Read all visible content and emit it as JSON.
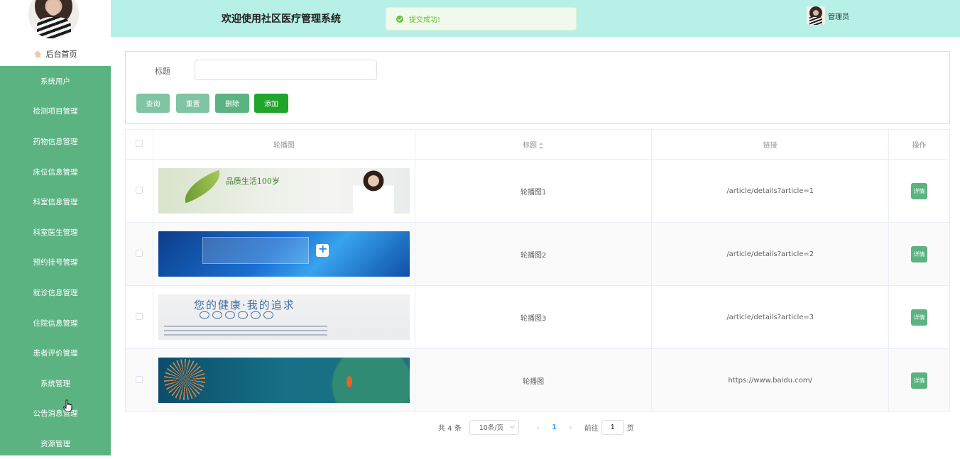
{
  "sidebar": {
    "home_label": "后台首页",
    "items": [
      {
        "label": "系统用户"
      },
      {
        "label": "检测项目管理"
      },
      {
        "label": "药物信息管理"
      },
      {
        "label": "床位信息管理"
      },
      {
        "label": "科室信息管理"
      },
      {
        "label": "科室医生管理"
      },
      {
        "label": "预约挂号管理"
      },
      {
        "label": "就诊信息管理"
      },
      {
        "label": "住院信息管理"
      },
      {
        "label": "患者评价管理"
      },
      {
        "label": "系统管理"
      },
      {
        "label": "公告消息管理"
      },
      {
        "label": "资源管理"
      }
    ]
  },
  "header": {
    "title": "欢迎使用社区医疗管理系统",
    "toast": "提交成功!",
    "user": "管理员"
  },
  "search": {
    "label": "标题",
    "value": "",
    "placeholder": "",
    "query": "查询",
    "reset": "重置",
    "delete": "删除",
    "add": "添加"
  },
  "table": {
    "columns": {
      "image": "轮播图",
      "title": "标题",
      "link": "链接",
      "action": "操作"
    },
    "rows": [
      {
        "title": "轮播图1",
        "link": "/article/details?article=1",
        "banner_text": "品质生活100岁",
        "action": "详情"
      },
      {
        "title": "轮播图2",
        "link": "/article/details?article=2",
        "action": "详情"
      },
      {
        "title": "轮播图3",
        "link": "/article/details?article=3",
        "banner_text": "您的健康·我的追求",
        "action": "详情"
      },
      {
        "title": "轮播图",
        "link": "https://www.baidu.com/",
        "action": "详情"
      }
    ]
  },
  "pagination": {
    "total": "共 4 条",
    "page_size": "10条/页",
    "current_page": "1",
    "goto_label": "前往",
    "goto_value": "1",
    "page_suffix": "页"
  },
  "colors": {
    "sidebar_bg": "#5bb381",
    "header_bg": "#b6f0e6",
    "success": "#67c23a",
    "add_button": "#1fa52a"
  }
}
